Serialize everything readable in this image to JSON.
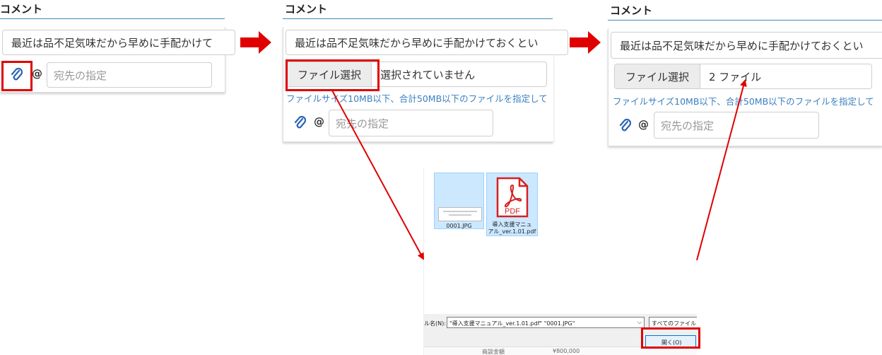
{
  "colors": {
    "accent_rule": "#3c8dbc",
    "arrow_red": "#e00000",
    "hint_blue": "#3a7fc0",
    "selection": "#cce8ff"
  },
  "panel1": {
    "heading": "コメント",
    "comment_text": "最近は品不足気味だから早めに手配かけて",
    "clip_icon": "paperclip-icon",
    "at_symbol": "@",
    "dest_placeholder": "宛先の指定"
  },
  "panel2": {
    "heading": "コメント",
    "comment_text": "最近は品不足気味だから早めに手配かけておくとい",
    "file_button": "ファイル選択",
    "file_status": "選択されていません",
    "hint": "ファイルサイズ10MB以下、合計50MB以下のファイルを指定して",
    "clip_icon": "paperclip-icon",
    "at_symbol": "@",
    "dest_placeholder": "宛先の指定"
  },
  "panel3": {
    "heading": "コメント",
    "comment_text": "最近は品不足気味だから早めに手配かけておくとい",
    "file_button": "ファイル選択",
    "file_status": "2 ファイル",
    "hint": "ファイルサイズ10MB以下、合計50MB以下のファイルを指定して",
    "clip_icon": "paperclip-icon",
    "at_symbol": "@",
    "dest_placeholder": "宛先の指定"
  },
  "dialog": {
    "files": [
      {
        "name": "0001.JPG",
        "icon": "image-thumbnail-icon",
        "selected": true
      },
      {
        "name": "導入支援マニュアル_ver.1.01.pdf",
        "name_line1": "導入支援マニュ",
        "name_line2": "アル_ver.1.01.pdf",
        "icon": "pdf-file-icon",
        "badge": "PDF",
        "selected": true
      }
    ],
    "filename_label": "ル名(N):",
    "filename_value": "\"導入支援マニュアル_ver.1.01.pdf\" \"0001.JPG\"",
    "filetype_value": "すべてのファイル (*",
    "open_button": "開く(O)",
    "background_row_left": "商談金額",
    "background_row_right": "¥800,000"
  }
}
